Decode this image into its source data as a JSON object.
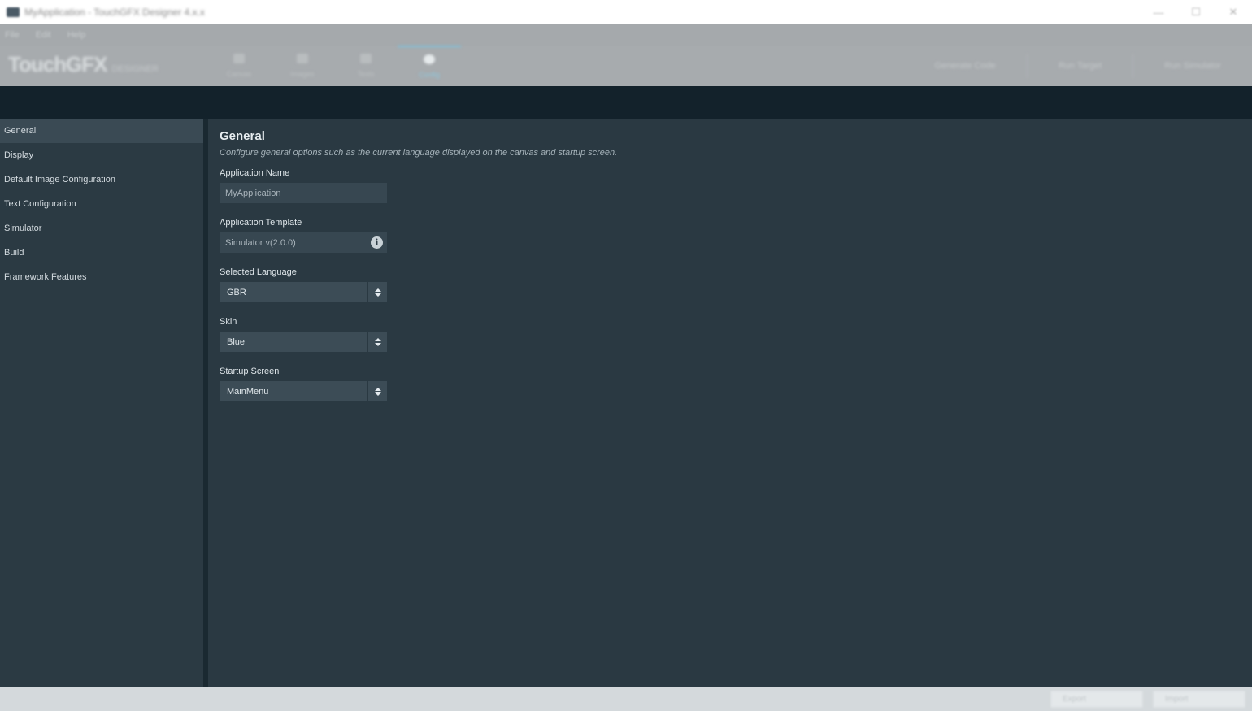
{
  "titlebar": {
    "title": "MyApplication - TouchGFX Designer 4.x.x",
    "minimize": "—",
    "maximize": "☐",
    "close": "✕"
  },
  "menubar": {
    "items": [
      "File",
      "Edit",
      "Help"
    ]
  },
  "toolbar": {
    "logo_main": "TouchGFX",
    "logo_sub": "DESIGNER",
    "tabs": [
      {
        "label": "Canvas",
        "icon": "canvas-icon"
      },
      {
        "label": "Images",
        "icon": "images-icon"
      },
      {
        "label": "Texts",
        "icon": "texts-icon"
      },
      {
        "label": "Config",
        "icon": "config-icon"
      }
    ],
    "actions": [
      "Generate Code",
      "Run Target",
      "Run Simulator"
    ]
  },
  "sidebar": {
    "items": [
      {
        "label": "General"
      },
      {
        "label": "Display"
      },
      {
        "label": "Default Image Configuration"
      },
      {
        "label": "Text Configuration"
      },
      {
        "label": "Simulator"
      },
      {
        "label": "Build"
      },
      {
        "label": "Framework Features"
      }
    ],
    "selected_index": 0
  },
  "main": {
    "title": "General",
    "description": "Configure general options such as the current language displayed on the canvas and startup screen.",
    "application_name": {
      "label": "Application Name",
      "value": "MyApplication"
    },
    "application_template": {
      "label": "Application Template",
      "value": "Simulator v(2.0.0)",
      "info_glyph": "i"
    },
    "selected_language": {
      "label": "Selected Language",
      "value": "GBR"
    },
    "skin": {
      "label": "Skin",
      "value": "Blue"
    },
    "startup_screen": {
      "label": "Startup Screen",
      "value": "MainMenu"
    }
  },
  "statusbar": {
    "buttons": [
      "Export",
      "Import"
    ]
  },
  "colors": {
    "background": "#2a3942",
    "sidebar": "#2b3a43",
    "selected_row": "#3a4a54",
    "header_strip": "#13222b",
    "field": "#374751",
    "accent": "#7fc0da"
  }
}
